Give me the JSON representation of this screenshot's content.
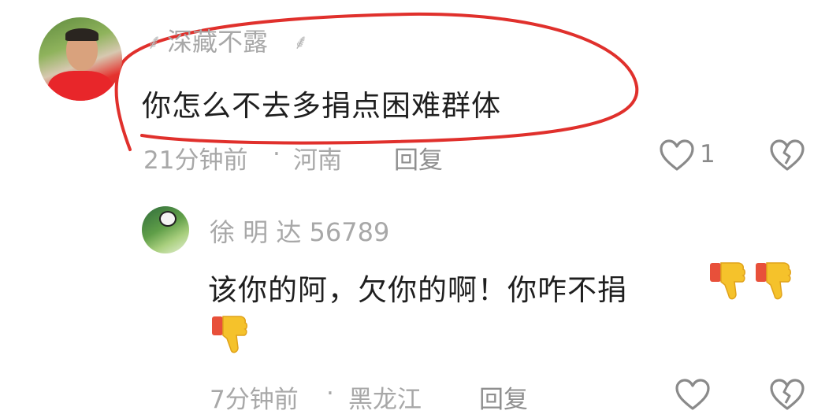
{
  "comments": [
    {
      "username": "深藏不露",
      "text": "你怎么不去多捐点困难群体",
      "time": "21分钟前",
      "location": "河南",
      "reply_label": "回复",
      "like_count": "1"
    },
    {
      "username": "徐 明 达 56789",
      "text": "该你的阿，欠你的啊！你咋不捐",
      "time": "7分钟前",
      "location": "黑龙江",
      "reply_label": "回复"
    }
  ],
  "separator": "·",
  "colors": {
    "annotation_circle": "#e0302c",
    "meta_text": "#a8a8a8",
    "comment_text": "#1f1f1f"
  },
  "icons": [
    "heart-icon",
    "broken-heart-icon",
    "thumbs-down-emoji"
  ]
}
